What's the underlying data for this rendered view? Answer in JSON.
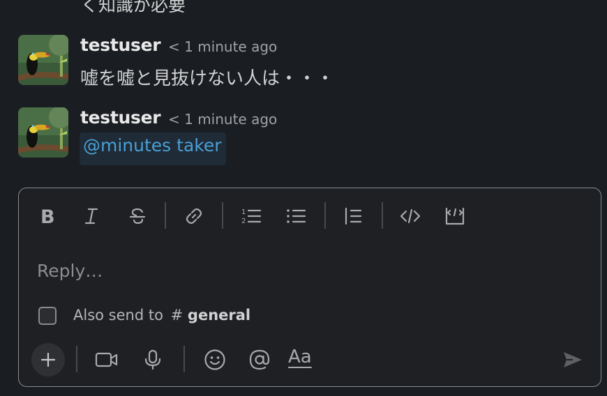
{
  "previous_message_tail": "く知識が必要",
  "messages": [
    {
      "author": "testuser",
      "timestamp": "< 1 minute ago",
      "text": "嘘を嘘と見抜けない人は・・・"
    },
    {
      "author": "testuser",
      "timestamp": "< 1 minute ago",
      "mention": "@minutes taker"
    }
  ],
  "composer": {
    "toolbar": [
      "bold-icon",
      "italic-icon",
      "strikethrough-icon",
      "link-icon",
      "ordered-list-icon",
      "bulleted-list-icon",
      "blockquote-icon",
      "code-icon",
      "code-block-icon"
    ],
    "placeholder": "Reply…",
    "also_send_label": "Also send to",
    "also_send_hash": "#",
    "also_send_channel": "general",
    "also_send_checked": false,
    "format_label": "Aa",
    "bottom_icons": [
      "plus-icon",
      "video-icon",
      "microphone-icon",
      "emoji-icon",
      "mention-icon",
      "send-icon"
    ]
  },
  "colors": {
    "background": "#1a1d21",
    "mention_text": "#4a9fd6",
    "mention_bg": "#1f2b36",
    "text": "#d1d2d3",
    "muted": "#a0a2a5"
  }
}
